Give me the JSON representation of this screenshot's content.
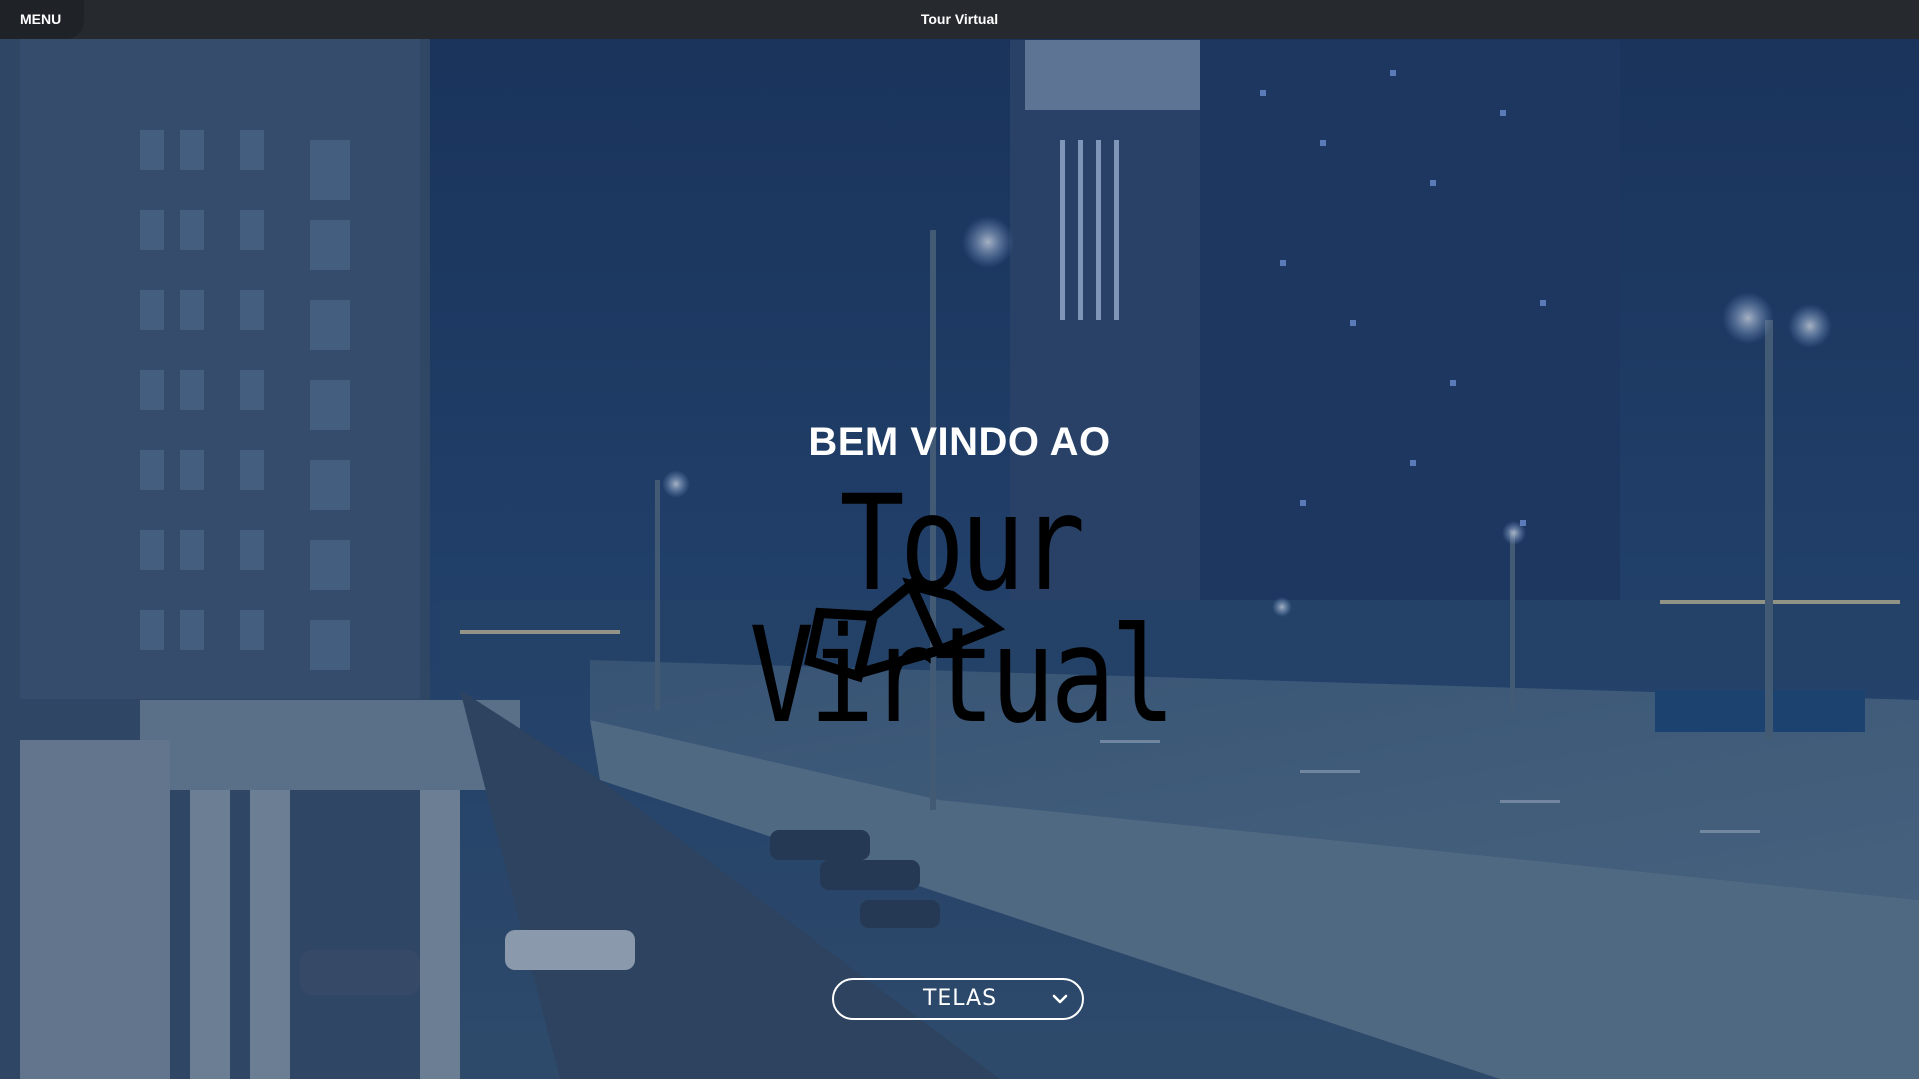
{
  "header": {
    "menu_label": "MENU",
    "title": "Tour Virtual"
  },
  "hero": {
    "welcome": "BEM VINDO AO",
    "logo_text": "Tour Virtual"
  },
  "screens_select": {
    "selected": "TELAS",
    "icon": "chevron-down-icon"
  },
  "colors": {
    "topbar": "#262a2e",
    "overlay": "#183462",
    "text": "#ffffff",
    "logo": "#000000"
  }
}
